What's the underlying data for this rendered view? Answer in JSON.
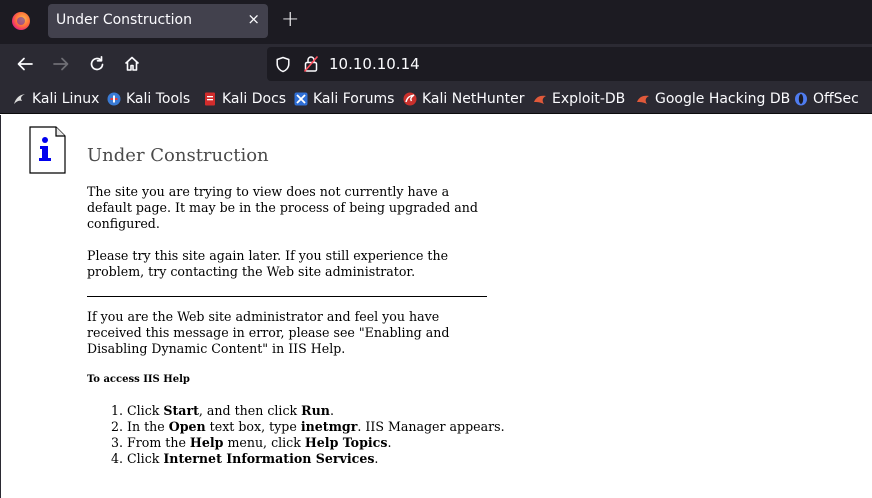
{
  "browser": {
    "tab": {
      "title": "Under Construction",
      "close_glyph": "×"
    },
    "newtab_glyph": "+",
    "url": "10.10.10.14",
    "bookmarks": [
      {
        "label": "Kali Linux",
        "icon": "kali-dragon-icon",
        "color": "#dddddd"
      },
      {
        "label": "Kali Tools",
        "icon": "kali-tools-icon",
        "color": "#3a7bd5"
      },
      {
        "label": "Kali Docs",
        "icon": "kali-docs-icon",
        "color": "#d22c2c"
      },
      {
        "label": "Kali Forums",
        "icon": "kali-forums-icon",
        "color": "#2f6fd6"
      },
      {
        "label": "Kali NetHunter",
        "icon": "kali-nethunter-icon",
        "color": "#c9302c"
      },
      {
        "label": "Exploit-DB",
        "icon": "exploit-db-icon",
        "color": "#e0593a"
      },
      {
        "label": "Google Hacking DB",
        "icon": "ghdb-icon",
        "color": "#e0593a"
      },
      {
        "label": "OffSec",
        "icon": "offsec-icon",
        "color": "#4f7cf0"
      }
    ]
  },
  "page": {
    "heading": "Under Construction",
    "p1": "The site you are trying to view does not currently have a default page. It may be in the process of being upgraded and configured.",
    "p2": "Please try this site again later. If you still experience the problem, try contacting the Web site administrator.",
    "p3": "If you are the Web site administrator and feel you have received this message in error, please see \"Enabling and Disabling Dynamic Content\" in IIS Help.",
    "help_heading": "To access IIS Help",
    "steps": [
      {
        "t1": "Click ",
        "b1": "Start",
        "t2": ", and then click ",
        "b2": "Run",
        "t3": "."
      },
      {
        "t1": "In the ",
        "b1": "Open",
        "t2": " text box, type ",
        "b2": "inetmgr",
        "t3": ". IIS Manager appears."
      },
      {
        "t1": "From the ",
        "b1": "Help",
        "t2": " menu, click ",
        "b2": "Help Topics",
        "t3": "."
      },
      {
        "t1": "Click ",
        "b1": "Internet Information Services",
        "t2": ".",
        "b2": "",
        "t3": ""
      }
    ]
  }
}
